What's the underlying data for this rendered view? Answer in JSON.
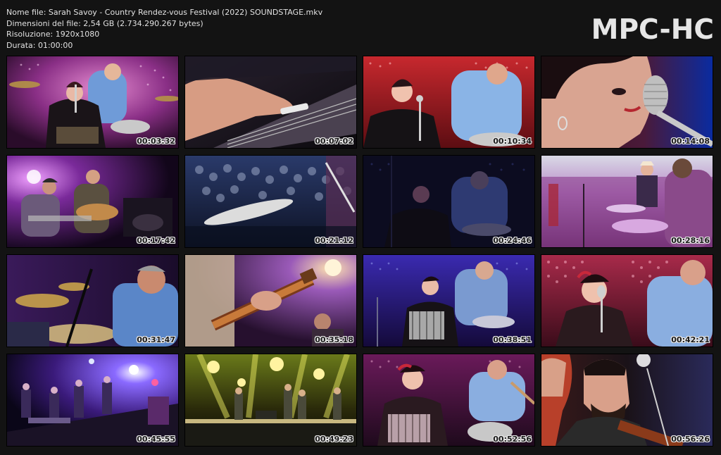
{
  "file_info": {
    "name_line": "Nome file: Sarah Savoy - Country Rendez-vous Festival (2022) SOUNDSTAGE.mkv",
    "size_line": "Dimensioni del file: 2,54 GB (2.734.290.267 bytes)",
    "resolution_line": "Risoluzione: 1920x1080",
    "duration_line": "Durata: 01:00:00"
  },
  "brand": "MPC-HC",
  "thumbnails": [
    {
      "timestamp": "00:03:32",
      "scene": "singer-and-drummer-pink-lights"
    },
    {
      "timestamp": "00:07:02",
      "scene": "hand-on-lap-steel-guitar"
    },
    {
      "timestamp": "00:10:34",
      "scene": "singer-and-drummer-red-lights"
    },
    {
      "timestamp": "00:14:08",
      "scene": "singer-closeup-microphone"
    },
    {
      "timestamp": "00:17:42",
      "scene": "guitarists-purple-stage"
    },
    {
      "timestamp": "00:21:12",
      "scene": "cymbals-over-crowd"
    },
    {
      "timestamp": "00:24:46",
      "scene": "dark-blue-stage"
    },
    {
      "timestamp": "00:28:16",
      "scene": "open-air-stage-pink"
    },
    {
      "timestamp": "00:31:47",
      "scene": "drummer-closeup"
    },
    {
      "timestamp": "00:35:18",
      "scene": "guitar-neck-closeup"
    },
    {
      "timestamp": "00:38:51",
      "scene": "accordion-singer-and-drummer"
    },
    {
      "timestamp": "00:42:21",
      "scene": "singer-and-drummer-dots"
    },
    {
      "timestamp": "00:45:55",
      "scene": "wide-stage-blue-lights"
    },
    {
      "timestamp": "00:49:23",
      "scene": "wide-stage-yellow-lights"
    },
    {
      "timestamp": "00:52:56",
      "scene": "accordion-and-drums"
    },
    {
      "timestamp": "00:56:26",
      "scene": "fiddler-closeup"
    }
  ]
}
